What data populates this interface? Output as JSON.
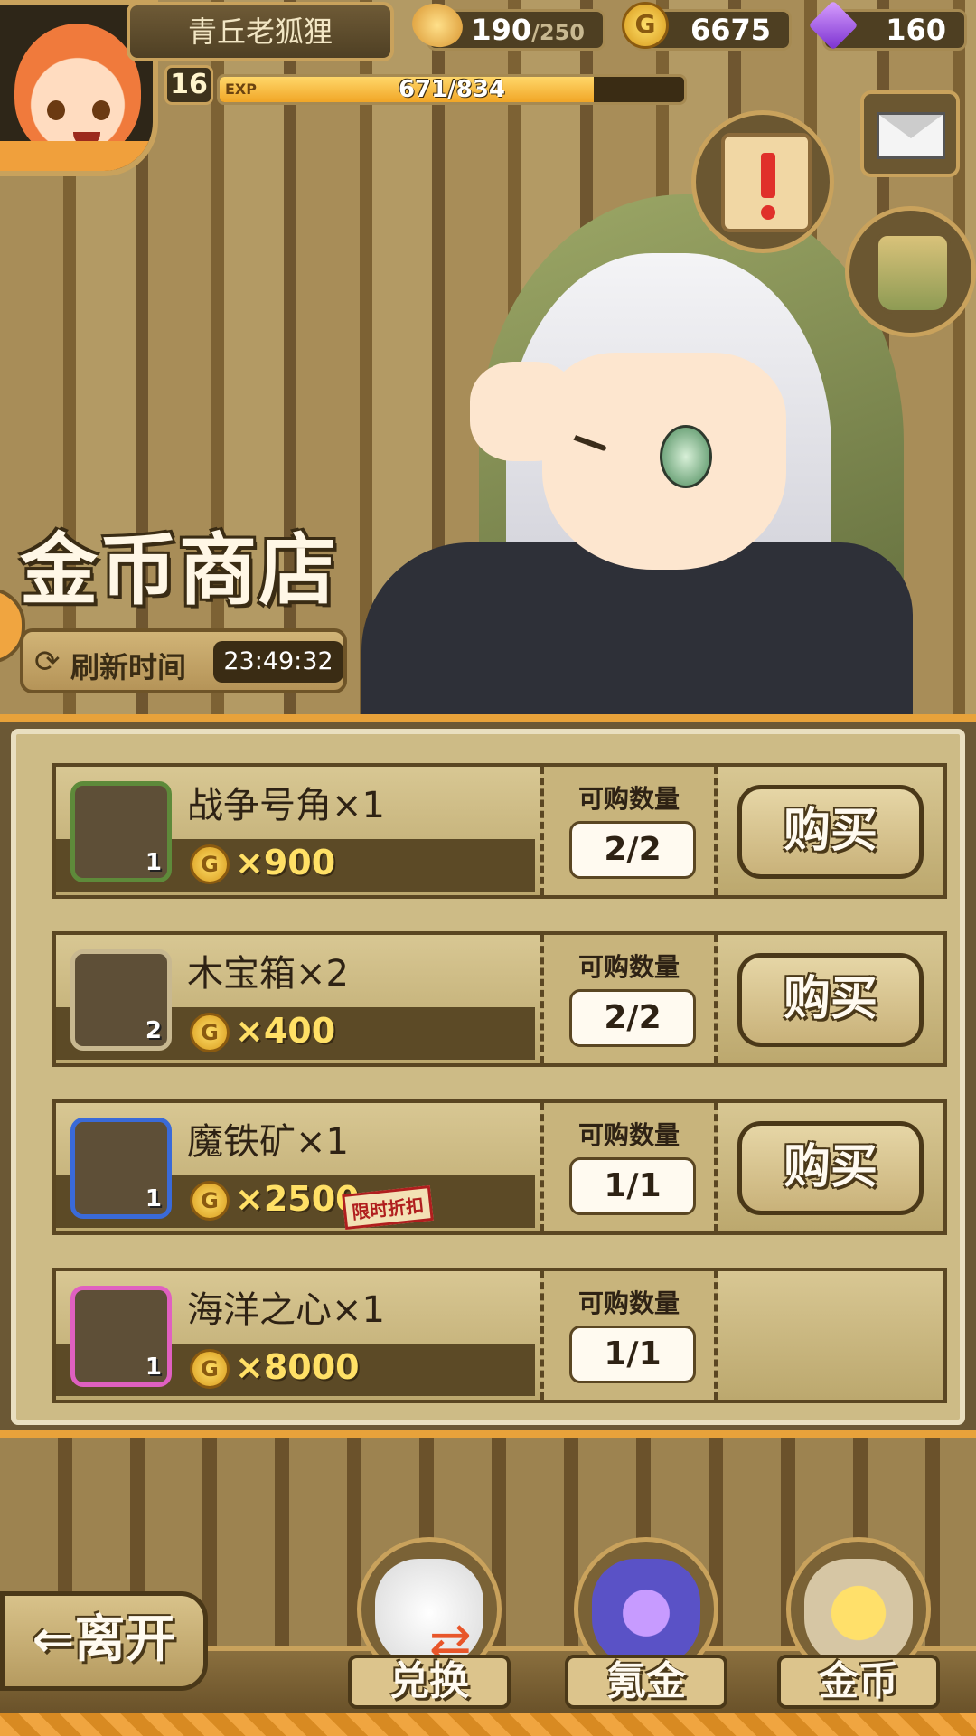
{
  "player": {
    "name": "青丘老狐狸",
    "level": "16",
    "exp_label": "EXP",
    "exp_text": "671/834",
    "exp_fraction": 0.805
  },
  "resources": {
    "stamina_current": "190",
    "stamina_max": "/250",
    "gold": "6675",
    "gems": "160"
  },
  "shop": {
    "title": "金币商店",
    "refresh_label": "刷新时间",
    "refresh_time": "23:49:32",
    "qty_label": "可购数量",
    "buy_label": "购买",
    "coin_glyph": "G",
    "items": [
      {
        "name": "战争号角×1",
        "count": "1",
        "price": "×900",
        "qty": "2/2",
        "frame_color": "#5e8a3a",
        "icon": "war-horn-icon",
        "discount": "",
        "has_buy": true
      },
      {
        "name": "木宝箱×2",
        "count": "2",
        "price": "×400",
        "qty": "2/2",
        "frame_color": "#c8b890",
        "icon": "wooden-chest-icon",
        "discount": "",
        "has_buy": true
      },
      {
        "name": "魔铁矿×1",
        "count": "1",
        "price": "×2500",
        "qty": "1/1",
        "frame_color": "#3a6ad8",
        "icon": "magic-iron-ore-icon",
        "discount": "限时折扣",
        "has_buy": true
      },
      {
        "name": "海洋之心×1",
        "count": "1",
        "price": "×8000",
        "qty": "1/1",
        "frame_color": "#e060c0",
        "icon": "ocean-heart-necklace-icon",
        "discount": "",
        "has_buy": false
      }
    ]
  },
  "nav": {
    "leave": "离开",
    "exchange": "兑换",
    "recharge": "氪金",
    "gold": "金币"
  }
}
